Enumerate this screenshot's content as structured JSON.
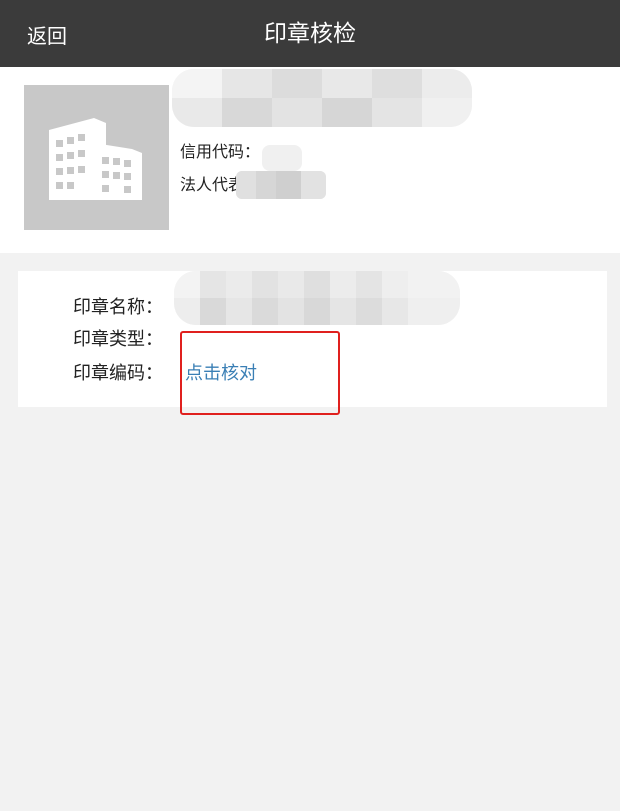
{
  "header": {
    "back_label": "返回",
    "title": "印章核检"
  },
  "company": {
    "logo_icon": "building-icon",
    "credit_code_label": "信用代码：",
    "legal_rep_label": "法人代表"
  },
  "seal": {
    "name_label": "印章名称：",
    "type_label": "印章类型：",
    "code_label": "印章编码：",
    "verify_link": "点击核对"
  },
  "colors": {
    "header_bg": "#3b3b3b",
    "link": "#3a7fb5",
    "highlight": "#e0201e",
    "page_bg": "#f2f2f2"
  }
}
